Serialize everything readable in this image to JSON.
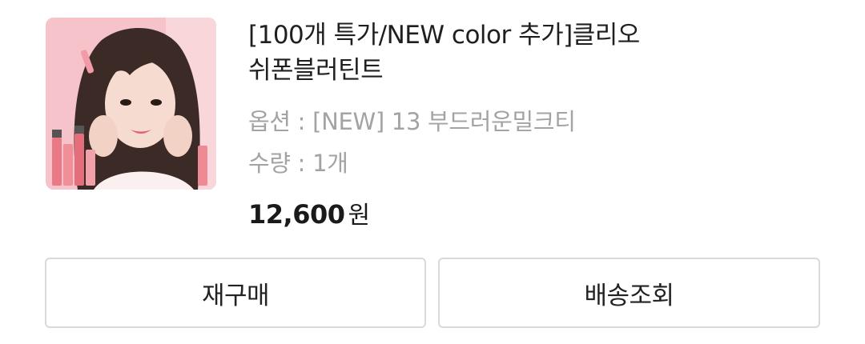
{
  "order_item": {
    "product_title": "[100개 특가/NEW color 추가]클리오 쉬폰블러틴트",
    "option_text": "옵션 : [NEW] 13 부드러운밀크티",
    "quantity_text": "수량 : 1개",
    "price_value": "12,600",
    "price_unit": "원",
    "thumbnail_icon": "product-photo-icon"
  },
  "actions": {
    "rebuy_label": "재구매",
    "tracking_label": "배송조회"
  },
  "colors": {
    "thumbnail_bg": "#f7b4bd",
    "muted_text": "#a3a3a3",
    "button_border": "#d9d9d9"
  }
}
